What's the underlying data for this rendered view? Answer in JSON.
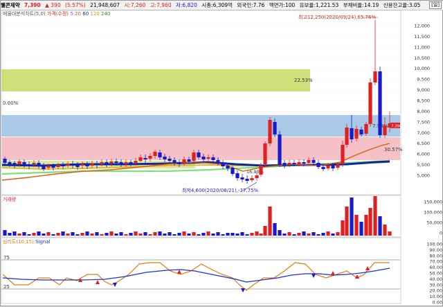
{
  "header": {
    "name": "웰콘제약",
    "price": "7,390",
    "change": "▲ 390",
    "pct": "(5.57%)",
    "volume": "21,948,607",
    "open": "시:7,260",
    "high": "고:7,960",
    "low": "저:6,820",
    "mcap": "시총:6,309억",
    "foreign": "외국인:7.76",
    "float": "액면가:100",
    "ratio": "유보율:1,221.53",
    "debt": "부채비율:14.19",
    "credit": "신용잔고율:3.05",
    "corner_btn": "[일]"
  },
  "price_panel": {
    "legend_items": [
      "매물대분석차트(5,0)",
      "가격(수정)",
      "5",
      "20",
      "60",
      "120",
      "240"
    ],
    "high_label": "최고12,250(2020/09/24),65.76%",
    "low_label": "최저4,600(2020/08/21),-37.75%",
    "band_labels": {
      "top": "22.53%",
      "blue": "7.93%",
      "pink": "30.57%",
      "left_pct": "0.00%",
      "mid": "16.90%"
    },
    "current_price_tag": "7,390",
    "y_ticks": [
      "12,000",
      "11,500",
      "11,000",
      "10,500",
      "10,000",
      "9,500",
      "9,000",
      "8,500",
      "8,000",
      "7,500",
      "7,000",
      "6,500",
      "6,000",
      "5,500",
      "5,000"
    ]
  },
  "volume_panel": {
    "title": "거래량",
    "y_ticks": [
      "150,000",
      "100,000",
      "50,000",
      "0"
    ]
  },
  "osc_panel": {
    "title": "심리도(10,15)",
    "signal": "Signal",
    "level_75": "75",
    "level_25": "25",
    "y_ticks": [
      "100.00",
      "90.00",
      "80.00",
      "70.00",
      "60.00",
      "50.00",
      "40.00",
      "30.00",
      "20.00",
      "10.00",
      "0.00"
    ]
  },
  "colors": {
    "up": "#e02020",
    "down": "#1a1acc",
    "band_green": "#cfe07a",
    "band_blue": "#a9c9e6",
    "band_pink": "#f5c0c6"
  }
}
